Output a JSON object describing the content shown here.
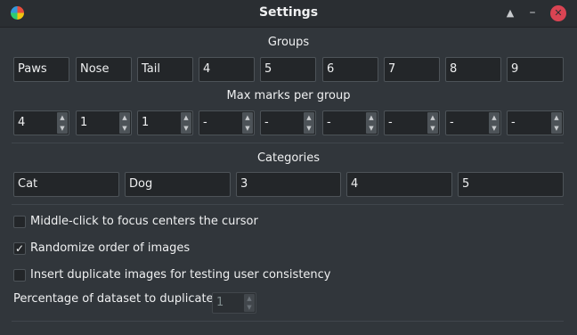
{
  "window": {
    "title": "Settings"
  },
  "groups": {
    "label": "Groups",
    "names": [
      "Paws",
      "Nose",
      "Tail",
      "4",
      "5",
      "6",
      "7",
      "8",
      "9"
    ]
  },
  "max_marks": {
    "label": "Max marks per group",
    "values": [
      "4",
      "1",
      "1",
      "-",
      "-",
      "-",
      "-",
      "-",
      "-"
    ]
  },
  "categories": {
    "label": "Categories",
    "names": [
      "Cat",
      "Dog",
      "3",
      "4",
      "5"
    ]
  },
  "options": {
    "middle_click": {
      "label": "Middle-click to focus centers the cursor",
      "checked": false
    },
    "randomize": {
      "label": "Randomize order of images",
      "checked": true
    },
    "duplicates": {
      "label": "Insert duplicate images for testing user consistency",
      "checked": false
    }
  },
  "duplicate_pct": {
    "label": "Percentage of dataset to duplicate:",
    "value": "1"
  }
}
